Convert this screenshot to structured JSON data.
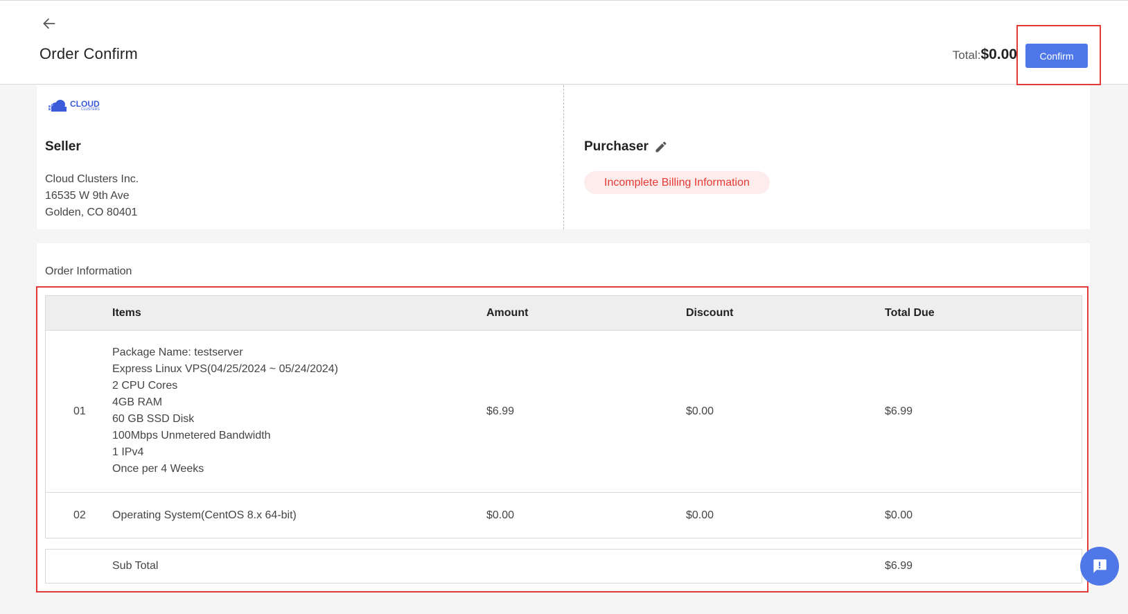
{
  "header": {
    "back_icon": "arrow-left-icon",
    "title": "Order Confirm",
    "total_label": "Total:",
    "total_value": "$0.00",
    "confirm_label": "Confirm"
  },
  "seller": {
    "logo_big": "CLOUD",
    "logo_small": "CLUSTERS",
    "title": "Seller",
    "lines": [
      "Cloud Clusters Inc.",
      "16535 W 9th Ave",
      "Golden, CO 80401"
    ]
  },
  "purchaser": {
    "title": "Purchaser",
    "edit_icon": "pencil-icon",
    "billing_status": "Incomplete Billing Information"
  },
  "order": {
    "title": "Order Information",
    "columns": [
      "Items",
      "Amount",
      "Discount",
      "Total Due"
    ],
    "rows": [
      {
        "no": "01",
        "item_lines": [
          "Package Name: testserver",
          "Express Linux VPS(04/25/2024 ~ 05/24/2024)",
          "2 CPU Cores",
          "4GB RAM",
          "60 GB SSD Disk",
          "100Mbps Unmetered Bandwidth",
          "1 IPv4",
          "Once per 4 Weeks"
        ],
        "amount": "$6.99",
        "discount": "$0.00",
        "total_due": "$6.99"
      },
      {
        "no": "02",
        "item_lines": [
          "Operating System(CentOS 8.x 64-bit)"
        ],
        "amount": "$0.00",
        "discount": "$0.00",
        "total_due": "$0.00"
      }
    ],
    "subtotal_label": "Sub Total",
    "subtotal_value": "$6.99"
  },
  "chat_icon": "chat-alert-icon",
  "colors": {
    "accent": "#4f77e8",
    "alert": "#e53935",
    "alert_bg": "#fdecec"
  }
}
